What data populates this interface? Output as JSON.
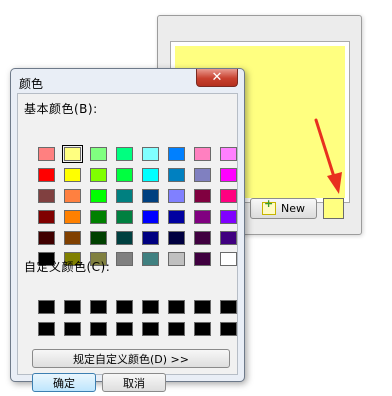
{
  "dialog": {
    "title": "颜色",
    "close_glyph": "✕",
    "basic_colors_label": "基本颜色(B):",
    "custom_colors_label": "自定义颜色(C):",
    "define_button": "规定自定义颜色(D) >>",
    "ok_button": "确定",
    "cancel_button": "取消",
    "selected_color": "#ffff80",
    "basic_colors": [
      "#ff8080",
      "#ffff80",
      "#80ff80",
      "#00ff80",
      "#80ffff",
      "#0080ff",
      "#ff80c0",
      "#ff80ff",
      "#ff0000",
      "#ffff00",
      "#80ff00",
      "#00ff40",
      "#00ffff",
      "#0080c0",
      "#8080c0",
      "#ff00ff",
      "#804040",
      "#ff8040",
      "#00ff00",
      "#008080",
      "#004080",
      "#8080ff",
      "#800040",
      "#ff0080",
      "#800000",
      "#ff8000",
      "#008000",
      "#008040",
      "#0000ff",
      "#0000a0",
      "#800080",
      "#8000ff",
      "#400000",
      "#804000",
      "#004000",
      "#004040",
      "#000080",
      "#000040",
      "#400040",
      "#400080",
      "#000000",
      "#808000",
      "#808040",
      "#808080",
      "#408080",
      "#c0c0c0",
      "#400040",
      "#ffffff"
    ],
    "custom_colors": [
      "#000000",
      "#000000",
      "#000000",
      "#000000",
      "#000000",
      "#000000",
      "#000000",
      "#000000",
      "#000000",
      "#000000",
      "#000000",
      "#000000",
      "#000000",
      "#000000",
      "#000000",
      "#000000"
    ]
  },
  "app": {
    "new_button": "New",
    "new_icon": "new-note-icon",
    "note_color": "#ffff80",
    "arrow_color": "#e8311f"
  }
}
